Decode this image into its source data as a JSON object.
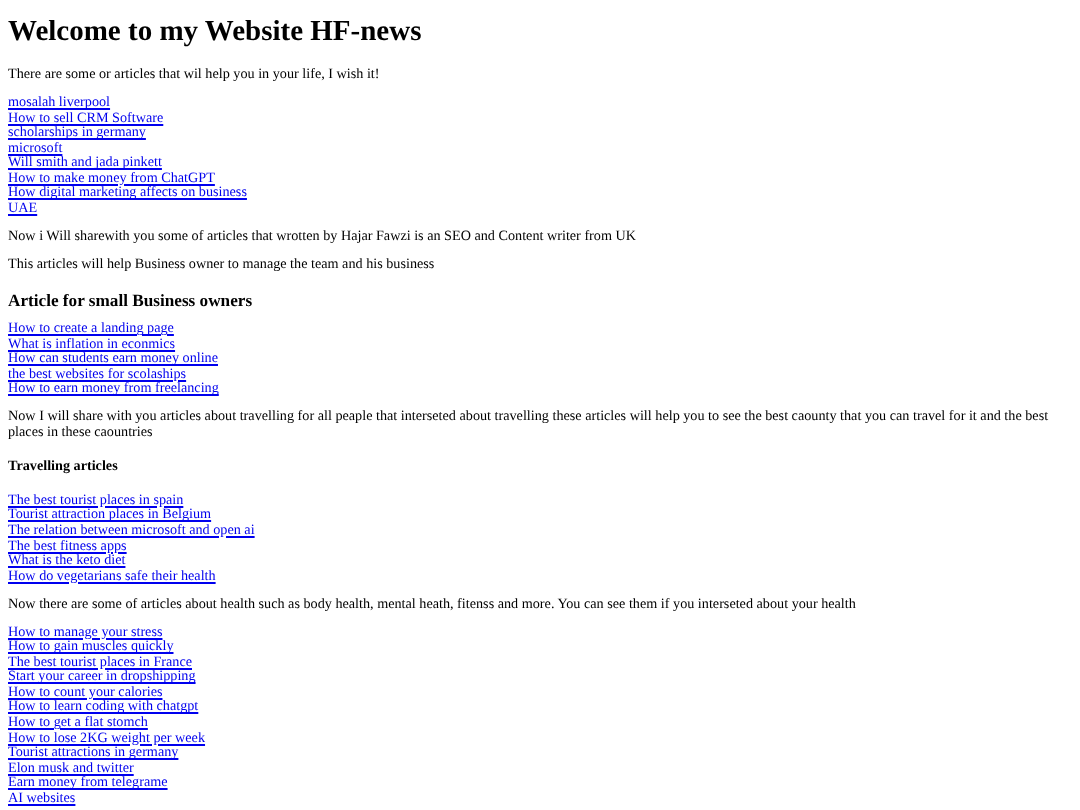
{
  "blocks": [
    {
      "kind": "h1",
      "text": "Welcome to my Website HF-news"
    },
    {
      "kind": "p",
      "text": "There are some or articles that wil help you in your life, I wish it!"
    },
    {
      "kind": "links",
      "items": [
        "mosalah liverpool",
        "How to sell CRM Software",
        "scholarships in germany",
        "microsoft",
        "Will smith and jada pinkett",
        "How to make money from ChatGPT",
        "How digital marketing affects on business",
        "UAE"
      ]
    },
    {
      "kind": "p",
      "text": "Now i Will sharewith you some of articles that wrotten by Hajar Fawzi is an SEO and Content writer from UK"
    },
    {
      "kind": "p",
      "text": "This articles will help Business owner to manage the team and his business"
    },
    {
      "kind": "h3",
      "text": "Article for small Business owners"
    },
    {
      "kind": "links",
      "items": [
        "How to create a landing page",
        "What is inflation in econmics",
        "How can students earn money online",
        "the best websites for scolaships",
        "How to earn money from freelancing"
      ]
    },
    {
      "kind": "p",
      "text": "Now I will share with you articles about travelling for all peaple that interseted about travelling these articles will help you to see the best caounty that you can travel for it and the best places in these caountries"
    },
    {
      "kind": "h4",
      "text": "Travelling articles"
    },
    {
      "kind": "links",
      "items": [
        "The best tourist places in spain",
        "Tourist attraction places in Belgium",
        "The relation between microsoft and open ai",
        "The best fitness apps",
        "What is the keto diet",
        "How do vegetarians safe their health"
      ]
    },
    {
      "kind": "p",
      "text": "Now there are some of articles about health such as body health, mental heath, fitenss and more. You can see them if you interseted about your health"
    },
    {
      "kind": "links",
      "items": [
        "How to manage your stress",
        "How to gain muscles quickly",
        "The best tourist places in France",
        "Start your career in dropshipping",
        "How to count your calories",
        "How to learn coding with chatgpt",
        "How to get a flat stomch",
        "How to lose 2KG weight per week",
        "Tourist attractions in germany",
        "Elon musk and twitter",
        "Earn money from telegrame",
        "AI websites"
      ]
    }
  ]
}
